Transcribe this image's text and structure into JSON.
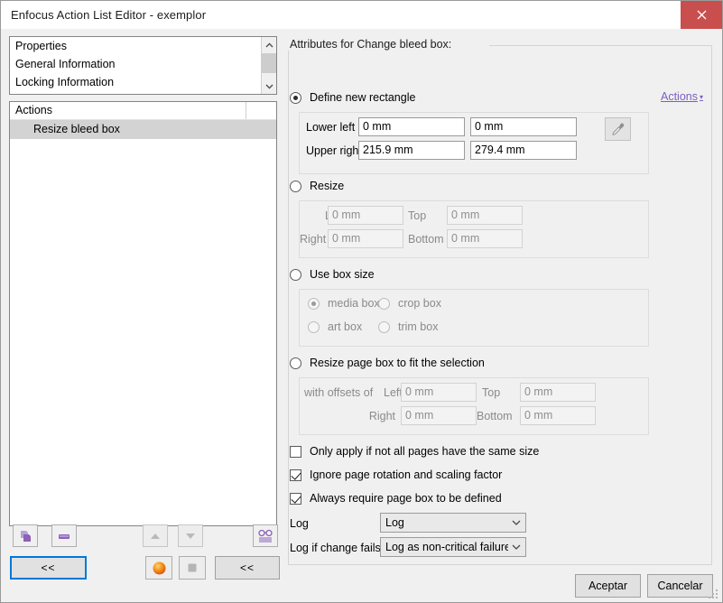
{
  "window": {
    "title": "Enfocus Action List Editor - exemplor",
    "close_label": "✕"
  },
  "left_panel": {
    "properties_list": {
      "items": [
        {
          "label": "Properties"
        },
        {
          "label": "General Information"
        },
        {
          "label": "Locking Information"
        }
      ]
    },
    "actions_list": {
      "header": "Actions",
      "rows": [
        {
          "label": "Resize bleed box",
          "selected": true
        }
      ]
    },
    "toolbar": {
      "add_icon": "duplicate-pages-icon",
      "remove_icon": "remove-dash-icon",
      "move_up_icon": "triangle-up-icon",
      "move_down_icon": "triangle-down-icon",
      "preview_icon": "glasses-icon",
      "back_button_label": "<<",
      "status_on_icon": "orange-sphere-icon",
      "status_off_icon": "grey-square-icon",
      "back_button2_label": "<<"
    }
  },
  "right_panel": {
    "group_title": "Attributes for Change bleed box:",
    "actions_link": {
      "label": "Actions",
      "caret": "▾"
    },
    "option_define_rect": {
      "label": "Define new rectangle",
      "selected": true,
      "rows": [
        {
          "label": "Lower left",
          "x": "0 mm",
          "y": "0 mm"
        },
        {
          "label": "Upper right",
          "x": "215.9 mm",
          "y": "279.4 mm"
        }
      ],
      "eyedropper_icon": "eyedropper-icon"
    },
    "option_resize": {
      "label": "Resize",
      "selected": false,
      "fields": [
        {
          "label": "Left",
          "value": "0 mm"
        },
        {
          "label": "Top",
          "value": "0 mm"
        },
        {
          "label": "Right",
          "value": "0 mm"
        },
        {
          "label": "Bottom",
          "value": "0 mm"
        }
      ]
    },
    "option_box_size": {
      "label": "Use box size",
      "selected": false,
      "choices": [
        {
          "label": "media box",
          "selected": true
        },
        {
          "label": "crop box",
          "selected": false
        },
        {
          "label": "art box",
          "selected": false
        },
        {
          "label": "trim box",
          "selected": false
        }
      ]
    },
    "option_fit_selection": {
      "label": "Resize page box to fit the selection",
      "selected": false,
      "prefix_label": "with offsets of",
      "fields": [
        {
          "label": "Left",
          "value": "0 mm"
        },
        {
          "label": "Top",
          "value": "0 mm"
        },
        {
          "label": "Right",
          "value": "0 mm"
        },
        {
          "label": "Bottom",
          "value": "0 mm"
        }
      ]
    },
    "checkboxes": [
      {
        "label": "Only apply if not all pages have the same size",
        "checked": false
      },
      {
        "label": "Ignore page rotation and scaling factor",
        "checked": true
      },
      {
        "label": "Always require page box to be defined",
        "checked": true
      }
    ],
    "log": {
      "label": "Log",
      "value": "Log"
    },
    "log_fail": {
      "label": "Log if change fails",
      "value": "Log as non-critical failure"
    }
  },
  "footer": {
    "ok_label": "Aceptar",
    "cancel_label": "Cancelar"
  },
  "colors": {
    "accent_purple": "#7b5fbf",
    "close_red": "#c94f4f",
    "focus_blue": "#0078d7",
    "window_bg": "#f0f0f0"
  }
}
